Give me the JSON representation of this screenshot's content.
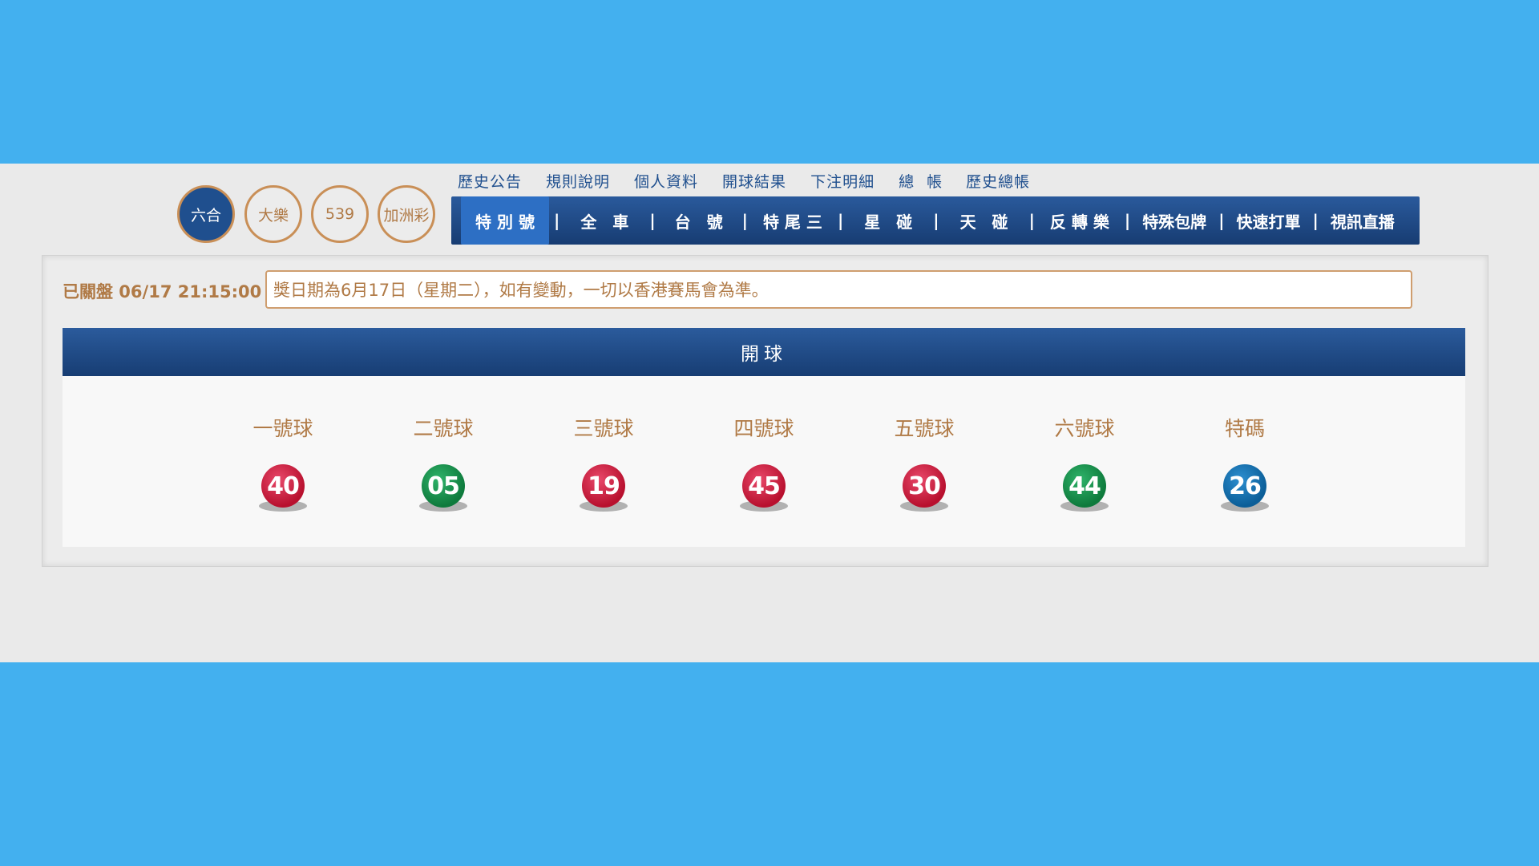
{
  "games": [
    {
      "label": "六合",
      "active": true
    },
    {
      "label": "大樂",
      "active": false
    },
    {
      "label": "539",
      "active": false
    },
    {
      "label": "加洲彩",
      "active": false
    }
  ],
  "top_links": [
    "歷史公告",
    "規則說明",
    "個人資料",
    "開球結果",
    "下注明細",
    "總帳",
    "歷史總帳"
  ],
  "tabs": [
    "特 別 號",
    "全　車",
    "台　號",
    "特 尾 三",
    "星　碰",
    "天　碰",
    "反 轉 樂",
    "特殊包牌",
    "快速打單",
    "視訊直播"
  ],
  "status": "已關盤 06/17 21:15:00",
  "notice": "獎日期為6月17日（星期二），如有變動，一切以香港賽馬會為準。",
  "draw": {
    "title": "開球",
    "balls": [
      {
        "label": "一號球",
        "number": "40",
        "color": "red"
      },
      {
        "label": "二號球",
        "number": "05",
        "color": "green"
      },
      {
        "label": "三號球",
        "number": "19",
        "color": "red"
      },
      {
        "label": "四號球",
        "number": "45",
        "color": "red"
      },
      {
        "label": "五號球",
        "number": "30",
        "color": "red"
      },
      {
        "label": "六號球",
        "number": "44",
        "color": "green"
      },
      {
        "label": "特碼",
        "number": "26",
        "color": "blue"
      }
    ]
  },
  "colors": {
    "background": "#43b0ef",
    "nav_blue": "#1f4f8e",
    "accent_tan": "#b07a46"
  }
}
